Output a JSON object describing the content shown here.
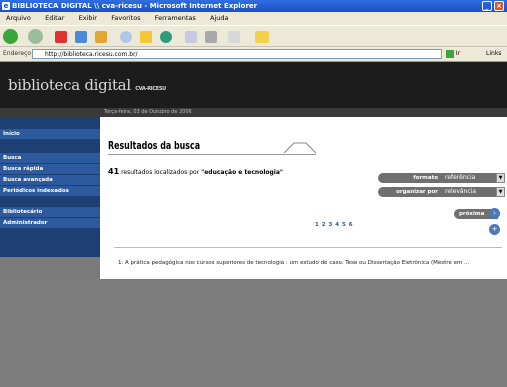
{
  "window": {
    "title": "BIBLIOTECA DIGITAL \\\\ cva-ricesu - Microsoft Internet Explorer",
    "ie_icon": "ie-icon",
    "minimize_icon": "minimize-icon",
    "close_icon": "close-icon"
  },
  "menubar": [
    "Arquivo",
    "Editar",
    "Exibir",
    "Favoritos",
    "Ferramentas",
    "Ajuda"
  ],
  "toolbar": {
    "icons": [
      "back-icon",
      "forward-icon",
      "stop-icon",
      "refresh-icon",
      "home-icon",
      "search-icon",
      "favorites-icon",
      "history-icon",
      "mail-icon",
      "print-icon",
      "edit-icon",
      "folder-icon"
    ]
  },
  "addressbar": {
    "label": "Endereço",
    "url": "http://biblioteca.ricesu.com.br/",
    "go_label": "Ir",
    "links_label": "Links"
  },
  "banner": {
    "logo_text": "biblioteca digital",
    "logo_suffix": "CVA-RICESU"
  },
  "datebar": {
    "text": "Terça-feira, 03 de Outubro de 2006"
  },
  "sidebar": {
    "items": [
      {
        "label": "Início"
      },
      {
        "label": "Busca"
      },
      {
        "label": "Busca rápida"
      },
      {
        "label": "Busca avançada"
      },
      {
        "label": "Periódicos indexados"
      },
      {
        "label": "Bibliotecário"
      },
      {
        "label": "Administrador"
      }
    ]
  },
  "main": {
    "title": "Resultados da busca",
    "count": "41",
    "count_text": "resultados localizados por",
    "query": "\"educação e tecnologia\"",
    "format_label": "formato",
    "format_value": "referência",
    "order_label": "organizar por",
    "order_value": "relevância",
    "pages": "1 2 3 4 5 6",
    "next_label": "próxima",
    "result_text": "1. A prática pedagógica nos cursos superiores de tecnologia : um estudo de caso. Tese ou Dissertação Eletrônica (Mestre em ..."
  },
  "colors": {
    "title_bar": "#1a4fc4",
    "banner": "#1c1c1c",
    "sidebar": "#1d3f73",
    "sidebar_item": "#2d5a9c",
    "control_grey": "#6f6f6f"
  }
}
